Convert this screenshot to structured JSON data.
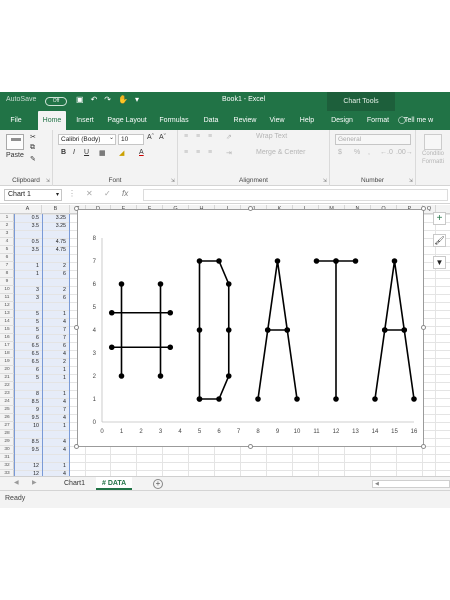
{
  "titlebar": {
    "autosave": "AutoSave",
    "autosave_state": "Off",
    "title": "Book1 - Excel",
    "chart_tools": "Chart Tools"
  },
  "tabs": [
    "File",
    "Home",
    "Insert",
    "Page Layout",
    "Formulas",
    "Data",
    "Review",
    "View",
    "Help",
    "Design",
    "Format"
  ],
  "active_tab": "Home",
  "tellme": "Tell me w",
  "ribbon": {
    "clipboard": {
      "label": "Clipboard",
      "paste": "Paste"
    },
    "font": {
      "label": "Font",
      "name": "Calibri (Body)",
      "size": "10"
    },
    "alignment": {
      "label": "Alignment",
      "wrap": "Wrap Text",
      "merge": "Merge & Center"
    },
    "number": {
      "label": "Number",
      "format": "General",
      "currency": "$",
      "percent": "%"
    },
    "styles": {
      "conditional_1": "Conditio",
      "conditional_2": "Formatti"
    }
  },
  "formula_bar": {
    "name_box": "Chart 1",
    "fx": "fx",
    "value": ""
  },
  "columns": [
    "A",
    "B",
    "C",
    "D",
    "E",
    "F",
    "G",
    "H",
    "I",
    "J",
    "K",
    "L",
    "M",
    "N",
    "O",
    "P",
    "Q"
  ],
  "rows": [
    "1",
    "2",
    "3",
    "4",
    "5",
    "6",
    "7",
    "8",
    "9",
    "10",
    "11",
    "12",
    "13",
    "14",
    "15",
    "16",
    "17",
    "18",
    "19",
    "20",
    "21",
    "22",
    "23",
    "24",
    "25",
    "26",
    "27",
    "28",
    "29",
    "30",
    "31",
    "32",
    "33"
  ],
  "cells": {
    "A": [
      "0.5",
      "3.5",
      "",
      "0.5",
      "3.5",
      "",
      "1",
      "1",
      "",
      "3",
      "3",
      "",
      "5",
      "5",
      "5",
      "6",
      "6.5",
      "6.5",
      "6.5",
      "6",
      "5",
      "",
      "8",
      "8.5",
      "9",
      "9.5",
      "10",
      "",
      "8.5",
      "9.5",
      "",
      "12",
      "12"
    ],
    "B": [
      "3.25",
      "3.25",
      "",
      "4.75",
      "4.75",
      "",
      "2",
      "6",
      "",
      "2",
      "6",
      "",
      "1",
      "4",
      "7",
      "7",
      "6",
      "4",
      "2",
      "1",
      "1",
      "",
      "1",
      "4",
      "7",
      "4",
      "1",
      "",
      "4",
      "4",
      "",
      "1",
      "4"
    ]
  },
  "sheet_tabs": [
    "Chart1",
    "# DATA"
  ],
  "active_sheet": "# DATA",
  "status": "Ready",
  "chart_data": {
    "type": "scatter",
    "title": "",
    "xlabel": "",
    "ylabel": "",
    "xlim": [
      0,
      16
    ],
    "ylim": [
      0,
      8
    ],
    "xticks": [
      "0",
      "1",
      "2",
      "3",
      "4",
      "5",
      "6",
      "7",
      "8",
      "9",
      "10",
      "11",
      "12",
      "13",
      "14",
      "15",
      "16"
    ],
    "yticks": [
      "0",
      "1",
      "2",
      "3",
      "4",
      "5",
      "6",
      "7",
      "8"
    ],
    "grid": false,
    "series": [
      {
        "x": [
          0.5,
          3.5
        ],
        "y": [
          3.25,
          3.25
        ]
      },
      {
        "x": [
          0.5,
          3.5
        ],
        "y": [
          4.75,
          4.75
        ]
      },
      {
        "x": [
          1,
          1
        ],
        "y": [
          2,
          6
        ]
      },
      {
        "x": [
          3,
          3
        ],
        "y": [
          2,
          6
        ]
      },
      {
        "x": [
          5,
          5,
          5,
          6,
          6.5,
          6.5,
          6.5,
          6,
          5
        ],
        "y": [
          1,
          4,
          7,
          7,
          6,
          4,
          2,
          1,
          1
        ]
      },
      {
        "x": [
          8,
          8.5,
          9,
          9.5,
          10
        ],
        "y": [
          1,
          4,
          7,
          4,
          1
        ]
      },
      {
        "x": [
          8.5,
          9.5
        ],
        "y": [
          4,
          4
        ]
      },
      {
        "x": [
          12,
          12
        ],
        "y": [
          1,
          7
        ]
      },
      {
        "x": [
          11,
          12,
          13
        ],
        "y": [
          7,
          7,
          7
        ]
      },
      {
        "x": [
          14,
          14.5,
          15,
          15.5,
          16
        ],
        "y": [
          1,
          4,
          7,
          4,
          1
        ]
      },
      {
        "x": [
          14.5,
          15.5
        ],
        "y": [
          4,
          4
        ]
      }
    ]
  }
}
